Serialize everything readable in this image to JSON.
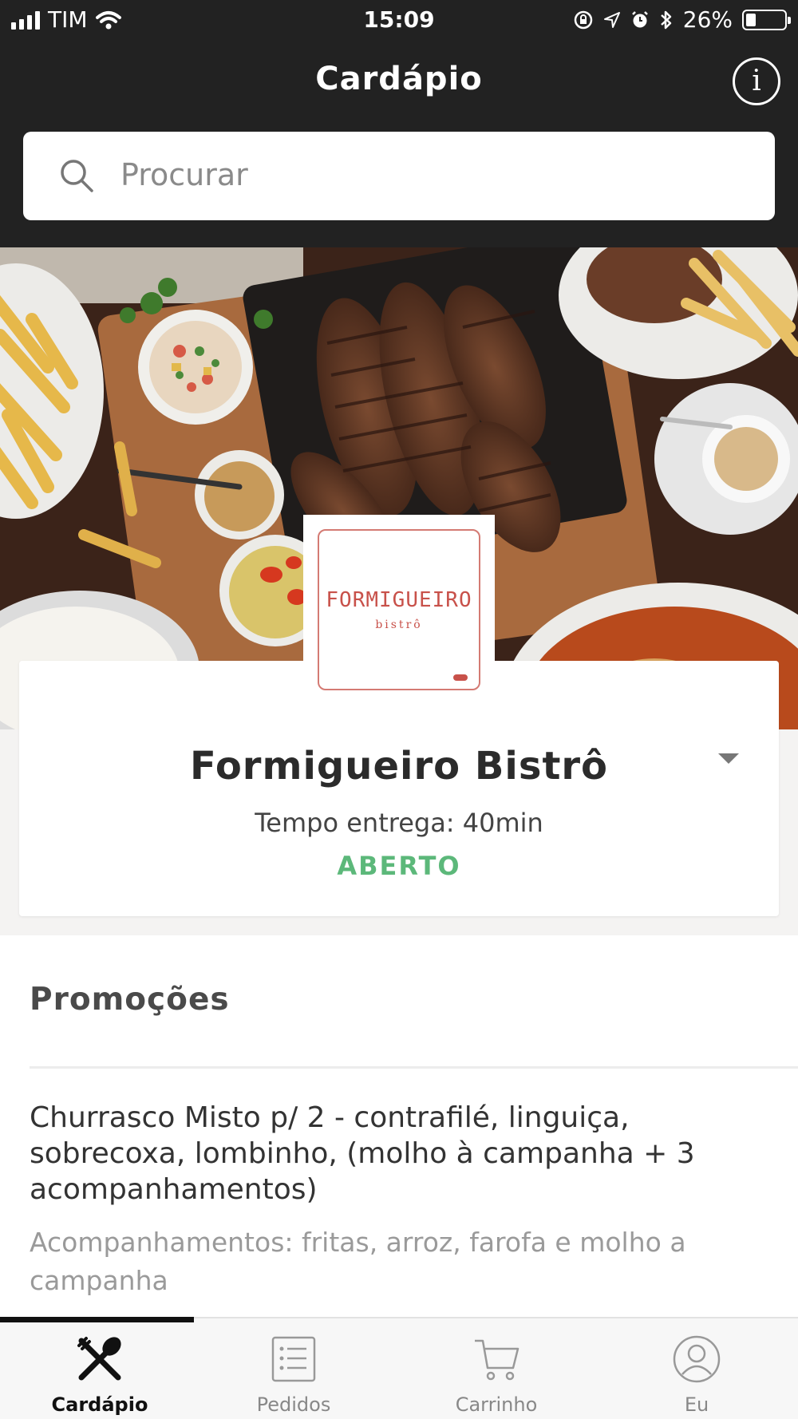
{
  "status_bar": {
    "carrier": "TIM",
    "time": "15:09",
    "battery_percent": "26%",
    "battery_level": 0.26,
    "icons": [
      "signal-icon",
      "wifi-icon",
      "orientation-lock-icon",
      "location-icon",
      "alarm-icon",
      "bluetooth-icon",
      "battery-icon"
    ]
  },
  "header": {
    "title": "Cardápio",
    "info_icon": "i"
  },
  "search": {
    "placeholder": "Procurar"
  },
  "restaurant": {
    "logo_brand": "FORMIGUEIRO",
    "logo_sub": "bistrô",
    "name": "Formigueiro Bistrô",
    "delivery_time": "Tempo entrega: 40min",
    "status": "ABERTO",
    "status_color": "#5cb87a",
    "logo_color": "#c8514a"
  },
  "promotions": {
    "title": "Promoções",
    "items": [
      {
        "title": "Churrasco Misto p/ 2 - contrafilé, linguiça, sobrecoxa, lombinho, (molho à campanha + 3 acompanhamentos)",
        "description": "Acompanhamentos: fritas, arroz, farofa e molho a campanha"
      }
    ]
  },
  "tabbar": {
    "active": 0,
    "tabs": [
      {
        "label": "Cardápio",
        "icon": "fork-spoon-icon"
      },
      {
        "label": "Pedidos",
        "icon": "list-icon"
      },
      {
        "label": "Carrinho",
        "icon": "cart-icon"
      },
      {
        "label": "Eu",
        "icon": "user-icon"
      }
    ]
  },
  "colors": {
    "header_bg": "#222222",
    "active_tab": "#111111",
    "inactive_tab": "#888888"
  }
}
